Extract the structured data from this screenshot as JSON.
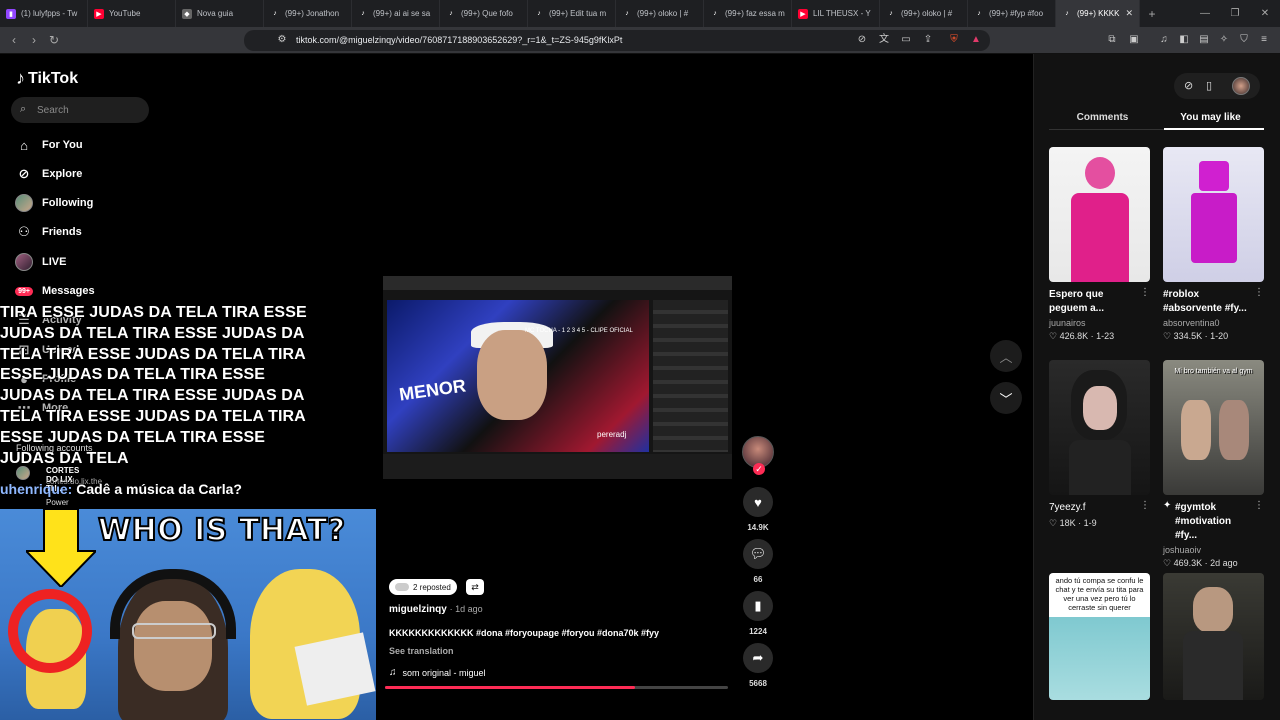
{
  "browser": {
    "tabs": [
      {
        "label": "(1) lulyfpps - Tw",
        "color": "#9146ff"
      },
      {
        "label": "YouTube",
        "color": "#ff0033"
      },
      {
        "label": "Nova guia",
        "color": "#666666"
      },
      {
        "label": "(99+) Jonathon",
        "color": "#111111"
      },
      {
        "label": "(99+) ai ai se sa",
        "color": "#111111"
      },
      {
        "label": "(99+) Que fofo",
        "color": "#111111"
      },
      {
        "label": "(99+) Edit tua m",
        "color": "#111111"
      },
      {
        "label": "(99+) oloko | #",
        "color": "#111111"
      },
      {
        "label": "(99+) faz essa m",
        "color": "#111111"
      },
      {
        "label": "LIL THEUSX - Y",
        "color": "#ff0033"
      },
      {
        "label": "(99+) oloko | #",
        "color": "#111111"
      },
      {
        "label": "(99+) #fyp #foo",
        "color": "#111111"
      },
      {
        "label": "(99+) KKKK",
        "color": "#111111"
      }
    ],
    "url": "tiktok.com/@miguelzinqy/video/7608717188903652629?_r=1&_t=ZS-945g9fKlxPt"
  },
  "sidebar": {
    "logo": "TikTok",
    "search_placeholder": "Search",
    "items": [
      {
        "label": "For You",
        "icon": "home-icon",
        "glyph": "⌂"
      },
      {
        "label": "Explore",
        "icon": "compass-icon",
        "glyph": "◎"
      },
      {
        "label": "Following",
        "icon": "avatar-icon",
        "glyph": ""
      },
      {
        "label": "Friends",
        "icon": "friends-icon",
        "glyph": "👥"
      },
      {
        "label": "LIVE",
        "icon": "live-avatar-icon",
        "glyph": ""
      },
      {
        "label": "Messages",
        "icon": "messages-icon",
        "glyph": ""
      },
      {
        "label": "Activity",
        "icon": "activity-icon",
        "glyph": ""
      },
      {
        "label": "Upload",
        "icon": "upload-icon",
        "glyph": ""
      },
      {
        "label": "Profile",
        "icon": "profile-icon",
        "glyph": ""
      },
      {
        "label": "More",
        "icon": "more-icon",
        "glyph": ""
      }
    ],
    "messages_badge": "99+",
    "following_accounts_label": "Following accounts",
    "following_account_name": "CORTES DO LIX TH...",
    "following_account_handle": "cortes.do.lix.the",
    "power_label": "Power"
  },
  "overlay": {
    "scroll_lines": [
      "TIRA ESSE JUDAS DA TELA TIRA ESSE",
      "JUDAS DA TELA TIRA ESSE JUDAS DA",
      "TELA TIRA ESSE JUDAS DA TELA TIRA",
      "ESSE JUDAS DA TELA TIRA ESSE",
      "JUDAS DA TELA TIRA ESSE JUDAS DA",
      "TELA TIRA ESSE JUDAS DA TELA TIRA",
      "ESSE JUDAS DA TELA TIRA ESSE",
      "JUDAS DA TELA"
    ],
    "chat_user": "uhenrique:",
    "chat_message": "Cadê a música da Carla?",
    "meme_text": "WHO IS THAT?"
  },
  "video": {
    "inner_title": "MC TOCHA - 1 2 3 4 5 - CLIPE OFICIAL",
    "inner_logo": "MENOR",
    "inner_credit": "pereradj"
  },
  "post": {
    "reposted_label": "2 reposted",
    "author": "miguelzinqy",
    "time_ago": "· 1d ago",
    "caption": "KKKKKKKKKKKKK #dona #foryoupage #foryou #dona70k #fyy",
    "see_translation": "See translation",
    "sound": "som original - miguel",
    "progress": 0.73
  },
  "actions": {
    "likes": "14.9K",
    "comments": "66",
    "saves": "1224",
    "shares": "5668"
  },
  "right_panel": {
    "tabs": [
      "Comments",
      "You may like"
    ],
    "cards": [
      {
        "title": "Espero que peguem a...",
        "user": "juunairos",
        "likes": "426.8K",
        "date": "1-23"
      },
      {
        "title": "#roblox #absorvente #fy...",
        "user": "absorventina0",
        "likes": "334.5K",
        "date": "1-20"
      },
      {
        "title": "7yeezy.f",
        "user": "",
        "likes": "18K",
        "date": "1-9"
      },
      {
        "title": "#gymtok #motivation #fy...",
        "user": "joshuaoiv",
        "likes": "469.3K",
        "date": "2d ago"
      },
      {
        "title": "",
        "user": "",
        "likes": "",
        "date": ""
      },
      {
        "title": "",
        "user": "",
        "likes": "",
        "date": ""
      }
    ],
    "card4_overlay": "ando tú compa se confu le chat y te envía su tita para ver una vez pero tú lo cerraste sin querer",
    "card3_overlay": "Mi bro también va al gym"
  },
  "colors": {
    "accent": "#fe2c55",
    "background": "#000000",
    "panel": "#121212"
  }
}
